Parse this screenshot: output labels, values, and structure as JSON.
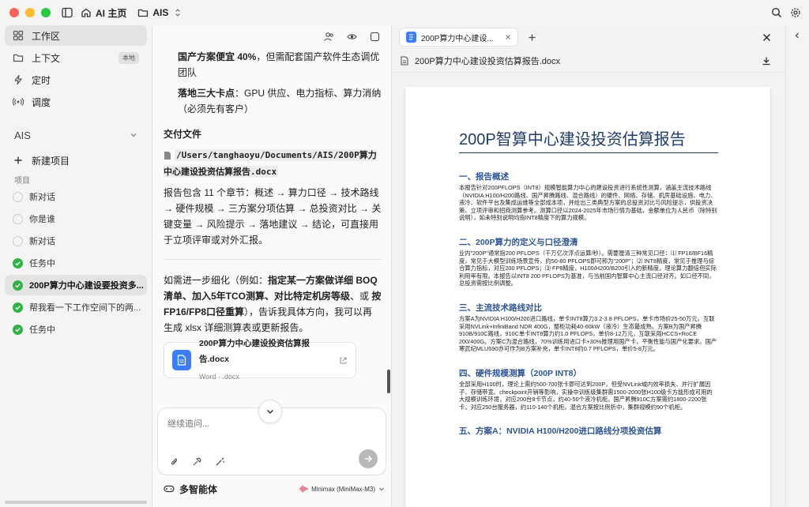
{
  "titlebar": {
    "home_label": "AI 主页",
    "folder_label": "AIS"
  },
  "sidebar": {
    "nav": [
      {
        "label": "工作区",
        "icon": "grid-icon"
      },
      {
        "label": "上下文",
        "icon": "folder-icon",
        "badge": "本地"
      },
      {
        "label": "定时",
        "icon": "bolt-icon"
      },
      {
        "label": "调度",
        "icon": "radio-icon"
      }
    ],
    "workspace_title": "AIS",
    "new_project": "新建项目",
    "projects_label": "项目",
    "tasks": [
      {
        "label": "新对话",
        "done": false
      },
      {
        "label": "你是谁",
        "done": false
      },
      {
        "label": "新对话",
        "done": false
      },
      {
        "label": "任务中",
        "done": true
      },
      {
        "label": "200P算力中心建设要投资多...",
        "done": true,
        "active": true
      },
      {
        "label": "帮我看一下工作空间下的两...",
        "done": true
      },
      {
        "label": "任务中",
        "done": true
      }
    ]
  },
  "chat": {
    "p1_bold": "国产方案便宜 40%",
    "p1_rest": "，但需配套国产软件生态调优团队",
    "p2_bold": "落地三大卡点",
    "p2_rest": "：GPU 供应、电力指标、算力消纳（必须先有客户）",
    "delivery_title": "交付文件",
    "file_path": "/Users/tanghaoyu/Documents/AIS/200P算力中心建设投资估算报告.docx",
    "summary": "报告包含 11 个章节：概述 → 算力口径 → 技术路线 → 硬件规模 → 三方案分项估算 → 总投资对比 → 关键变量 → 风险提示 → 落地建议 → 结论，可直接用于立项评审或对外汇报。",
    "followup_pre": "如需进一步细化（例如：",
    "followup_bold": "指定某一方案做详细 BOQ 清单、加入5年TCO测算、对比特定机房等级",
    "followup_mid": "、或 ",
    "followup_bold2": "按FP16/FP8口径重算",
    "followup_post": "），告诉我具体方向，我可以再生成 xlsx 详细测算表或更新报告。",
    "file_card": {
      "name": "200P算力中心建设投资估算报告.docx",
      "meta": "Word · .docx"
    },
    "input_placeholder": "继续追问...",
    "agent_label": "多智能体",
    "model_label": "Minimax (MiniMax-M3)"
  },
  "doc": {
    "tab_label": "200P算力中心建设...",
    "path_label": "200P算力中心建设投资估算报告.docx",
    "title": "200P智算中心建设投资估算报告",
    "sections": [
      {
        "heading": "一、报告概述",
        "body": "本报告针对200PFLOPS（INT8）规模智能算力中心的建设投资进行系统性测算，涵盖主流技术路线（NVIDIA H100/H200路线、国产昇腾路线、混合路线）的硬件、网络、存储、机房基础设施、电力、液冷、软件平台及集成运维等全部成本项，并给出三类典型方案的总投资对比与风险提示，供投资决策、立项评审和招商测算参考。测算口径以2024-2025年市场行情为基础，金额单位为人民币（除特别说明），如未特别说明均指INT8精度下的算力规模。"
      },
      {
        "heading": "二、200P算力的定义与口径澄清",
        "body": "业内\"200P\"通常指200 PFLOPS（千万亿次浮点运算/秒）。需要厘清三种常见口径：⑴ FP16/BF16精度，常见于大模型训练场景宣传，约50-80 PFLOPS即可称为\"200P\"；⑵ INT8精度，常见于推理与综合算力指标，对应200 PFLOPS；⑶ FP8精度，H100/H200/B200引入的新精度，理论算力翻倍但实际利用率有限。本报告以INT8 200 PFLOPS为基准，与当前国内智算中心主流口径对齐。如口径不同，总投资需按比例调整。"
      },
      {
        "heading": "三、主流技术路线对比",
        "body": "方案A为NVIDIA H100/H200进口路线，单卡INT8算力3.2-3.8 PFLOPS，单卡市场价25-50万元，互联采用NVLink+InfiniBand NDR 400G，整柜功耗40-60kW（液冷）生态最成熟。方案B为国产昇腾910B/910C路线，910C单卡INT8算力约1.0 PFLOPS，单价8-12万元，互联采用HCCS+RoCE 200/400G。方案C为混合路线，70%训练用进口卡+30%推理用国产卡，平衡性能与国产化要求。国产寒武纪MLU590亦可作为B方案补充，单卡INT8约0.7 PFLOPS，单价5-8万元。"
      },
      {
        "heading": "四、硬件规模测算（200P INT8）",
        "body": "全部采用H100时，理论上需约500-700张卡即可达到200P，但受NVLink域内效率损失、并行扩展因子、存储带宽、checkpoint开销等影响，实操中训练级集群需1500-2000张H100级卡方能形成可用的大规模训练环境，对应200台8卡节点，约40-50个液冷机柜。国产昇腾910C方案需约1800-2200张卡，对应250台服务器，约110-140个机柜。混合方案按比例折中，集群规模约90个机柜。"
      },
      {
        "heading": "五、方案A：NVIDIA H100/H200进口路线分项投资估算",
        "body": ""
      }
    ]
  }
}
